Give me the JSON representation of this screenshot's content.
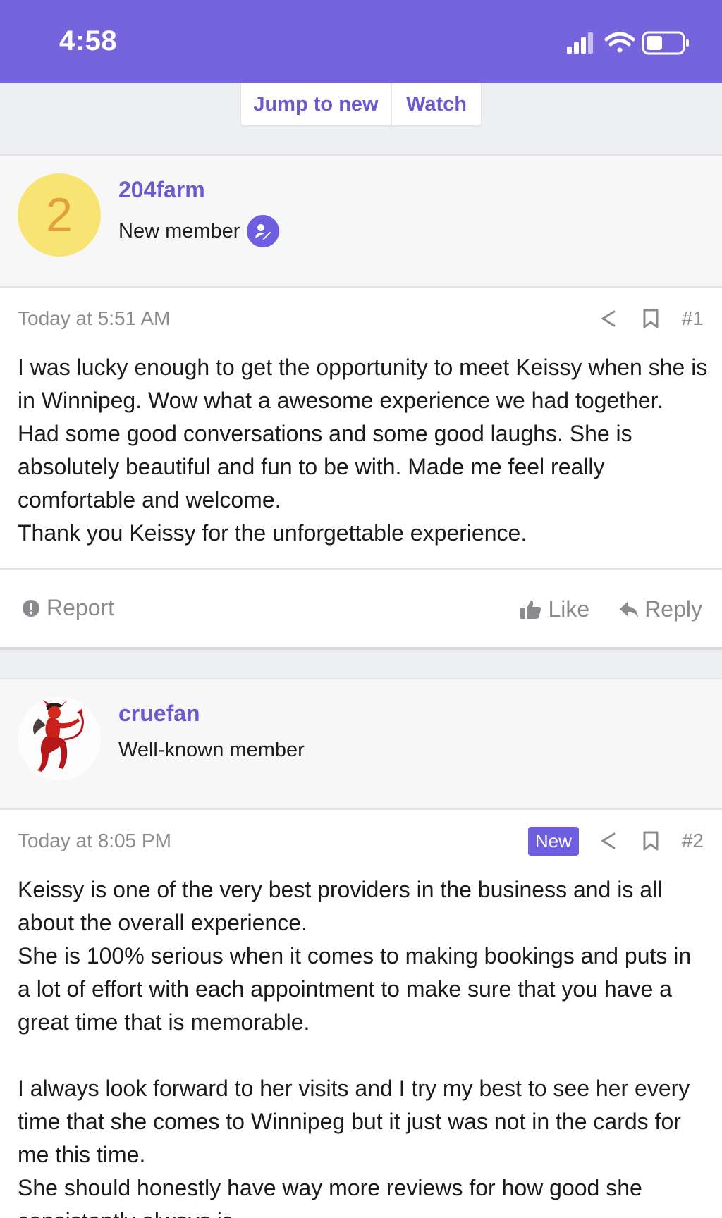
{
  "status_bar": {
    "time": "4:58",
    "icons": [
      "signal-icon",
      "wifi-icon",
      "battery-icon"
    ],
    "background": "#7564dc"
  },
  "thread_nav": {
    "jump_label": "Jump to new",
    "watch_label": "Watch"
  },
  "posts": [
    {
      "author": {
        "name": "204farm",
        "title": "New member",
        "avatar_letter": "2",
        "avatar_color": "#f8e473",
        "has_badge": true
      },
      "timestamp": "Today at 5:51 AM",
      "number": "#1",
      "paragraphs": [
        "I was lucky enough to get the opportunity to meet Keissy when she is in Winnipeg. Wow what a awesome experience we had together. Had some good conversations and some good laughs. She is absolutely beautiful and fun to be with. Made me feel really comfortable and welcome.",
        "Thank you Keissy for the unforgettable experience."
      ],
      "footer": {
        "report_label": "Report",
        "like_label": "Like",
        "reply_label": "Reply"
      }
    },
    {
      "author": {
        "name": "cruefan",
        "title": "Well-known member",
        "avatar_image": "red-devil-figure"
      },
      "timestamp": "Today at 8:05 PM",
      "new_label": "New",
      "number": "#2",
      "paragraphs": [
        "Keissy is one of the very best providers in the business and is all about the overall experience.",
        "She is 100% serious when it comes to making bookings and puts in a lot of effort with each appointment to make sure that you have a great time that is memorable.",
        "",
        "I always look forward to her visits and I try my best to see her every time that she comes to Winnipeg but it just was not in the cards for me this time.",
        "She should honestly have way more reviews for how good she consistently always is."
      ]
    }
  ],
  "colors": {
    "accent": "#6a5acd",
    "meta_text": "#8b8b8f",
    "new_badge": "#6d5ee2"
  }
}
